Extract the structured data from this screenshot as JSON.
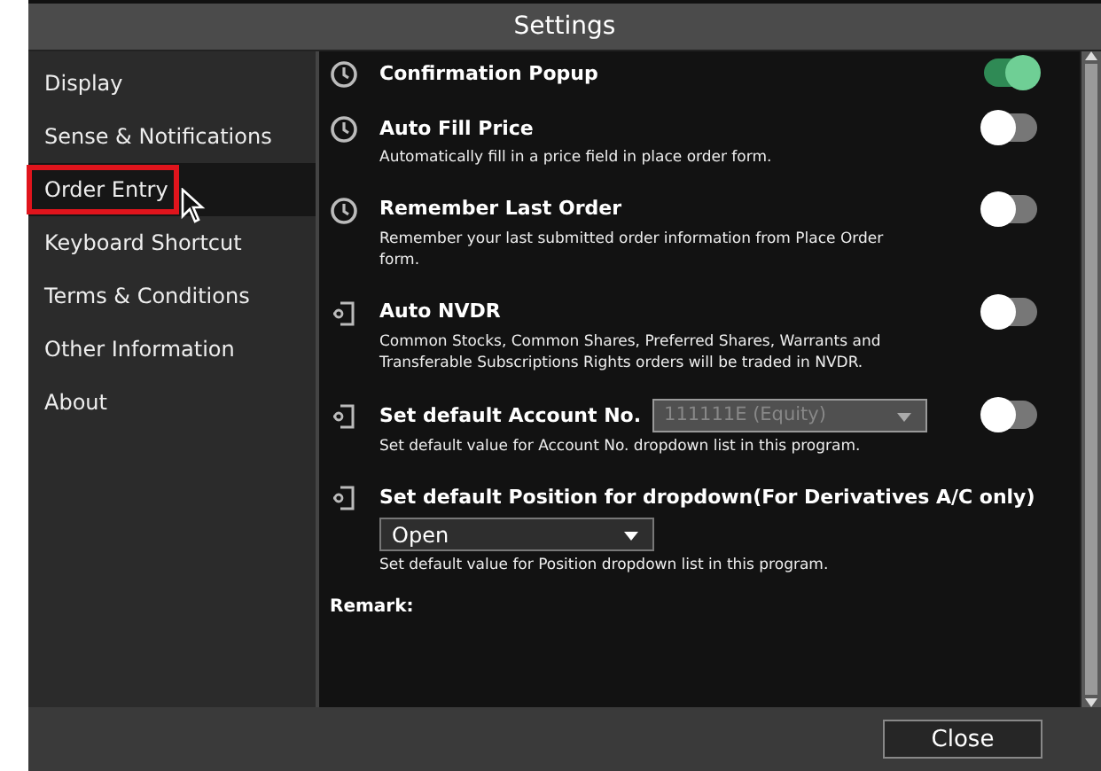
{
  "window": {
    "title": "Settings"
  },
  "sidebar": {
    "items": [
      {
        "label": "Display",
        "selected": false
      },
      {
        "label": "Sense & Notifications",
        "selected": false
      },
      {
        "label": "Order Entry",
        "selected": true
      },
      {
        "label": "Keyboard Shortcut",
        "selected": false
      },
      {
        "label": "Terms & Conditions",
        "selected": false
      },
      {
        "label": "Other Information",
        "selected": false
      },
      {
        "label": "About",
        "selected": false
      }
    ]
  },
  "settings": [
    {
      "kind": "clock-toggle",
      "title": "Confirmation Popup",
      "on": true
    },
    {
      "kind": "clock-toggle",
      "title": "Auto Fill Price",
      "description": "Automatically fill in a price field in place order form.",
      "on": false
    },
    {
      "kind": "clock-toggle",
      "title": "Remember Last Order",
      "description": "Remember your last submitted order information from Place Order form.",
      "on": false
    },
    {
      "kind": "door-toggle",
      "title": "Auto NVDR",
      "description": "Common Stocks, Common Shares, Preferred Shares, Warrants and Transferable Subscriptions Rights orders will be traded in NVDR.",
      "on": false
    },
    {
      "kind": "door-dropdown-toggle",
      "title": "Set default Account No.",
      "value": "111111E (Equity)",
      "disabled": true,
      "description": "Set default value for Account No. dropdown list in this program.",
      "on": false
    },
    {
      "kind": "door-dropdown",
      "title": "Set default Position for dropdown(For Derivatives A/C only)",
      "value": "Open",
      "disabled": false,
      "description": "Set default value for Position dropdown list in this program."
    }
  ],
  "remark": "Remark:",
  "buttons": [
    "Close"
  ]
}
